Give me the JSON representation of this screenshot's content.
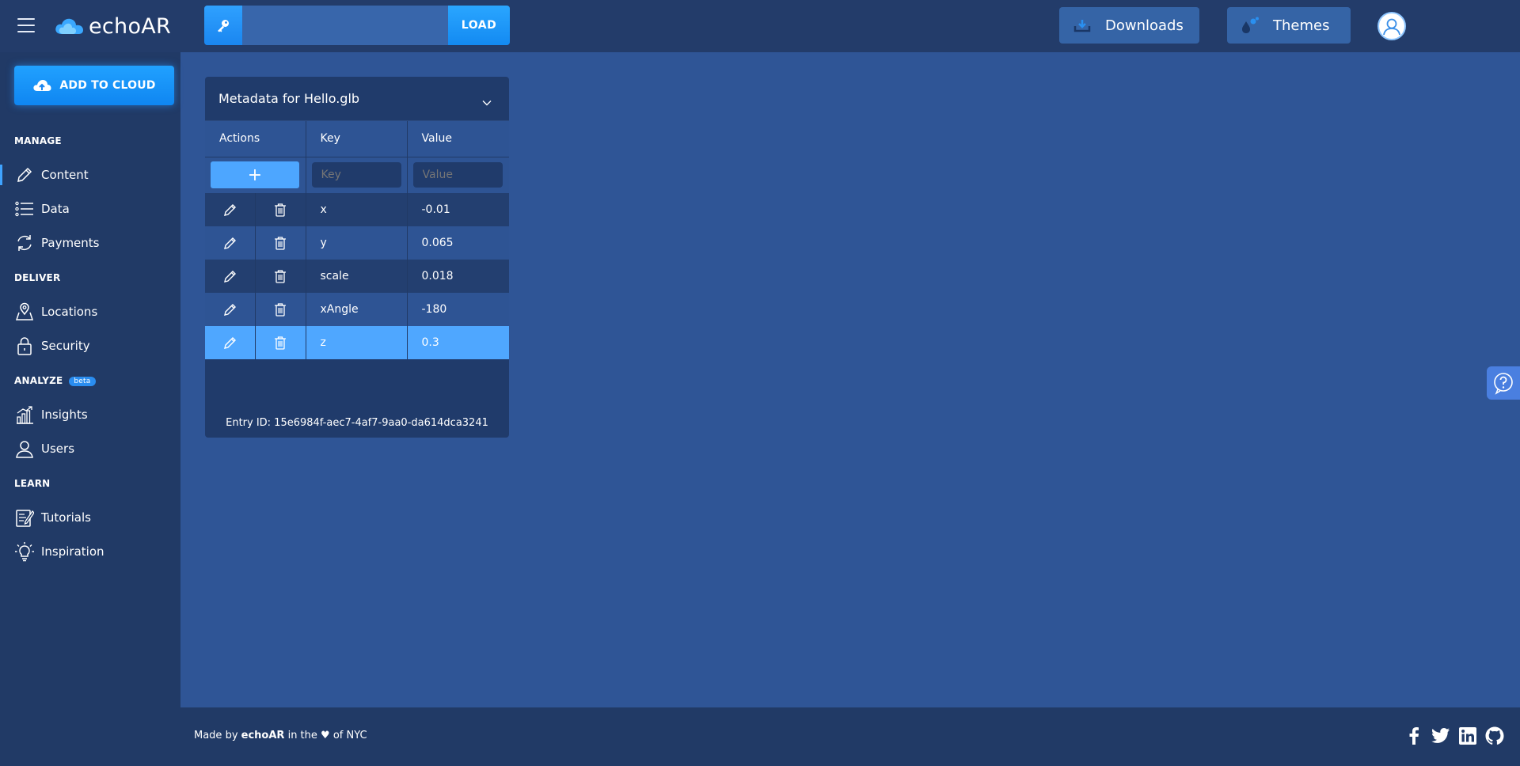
{
  "app": {
    "logo_text": "echoAR"
  },
  "header": {
    "key_input": {
      "value": "",
      "placeholder": ""
    },
    "load_label": "LOAD",
    "downloads_label": "Downloads",
    "themes_label": "Themes"
  },
  "sidebar": {
    "add_to_cloud_label": "ADD TO CLOUD",
    "sections": {
      "manage": "MANAGE",
      "deliver": "DELIVER",
      "analyze": "ANALYZE",
      "analyze_badge": "beta",
      "learn": "LEARN"
    },
    "items": {
      "content": "Content",
      "data": "Data",
      "payments": "Payments",
      "locations": "Locations",
      "security": "Security",
      "insights": "Insights",
      "users": "Users",
      "tutorials": "Tutorials",
      "inspiration": "Inspiration"
    }
  },
  "metadata_card": {
    "title": "Metadata for Hello.glb",
    "columns": {
      "actions": "Actions",
      "key": "Key",
      "value": "Value"
    },
    "new_entry": {
      "key_placeholder": "Key",
      "value_placeholder": "Value",
      "add_symbol": "+"
    },
    "rows": [
      {
        "key": "x",
        "value": "-0.01"
      },
      {
        "key": "y",
        "value": "0.065"
      },
      {
        "key": "scale",
        "value": "0.018"
      },
      {
        "key": "xAngle",
        "value": "-180"
      },
      {
        "key": "z",
        "value": "0.3"
      }
    ],
    "entry_id": "Entry ID: 15e6984f-aec7-4af7-9aa0-da614dca3241"
  },
  "footer": {
    "made_by": "Made by",
    "brand": "echoAR",
    "in_the": "in the",
    "heart": "♥",
    "of_nyc": "of NYC"
  },
  "colors": {
    "accent": "#1a8cf0",
    "background": "#2f5596",
    "sidebar": "#213a66",
    "selected_row": "#4fa7ff"
  }
}
